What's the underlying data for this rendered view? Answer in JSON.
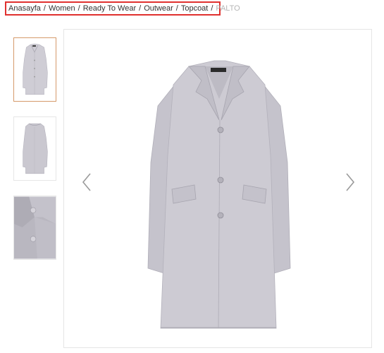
{
  "breadcrumb": {
    "items": [
      "Anasayfa",
      "Women",
      "Ready To Wear",
      "Outwear",
      "Topcoat"
    ],
    "current": "PALTO",
    "separator": "/"
  },
  "gallery": {
    "thumbnails": [
      "coat-front",
      "coat-back",
      "coat-detail"
    ],
    "active_index": 0,
    "main_image": "grey-boucle-coat",
    "prev_icon": "chevron-left-icon",
    "next_icon": "chevron-right-icon"
  },
  "colors": {
    "highlight_border": "#e0312f",
    "active_thumb_border": "#d59a6a",
    "coat": "#c9c7cf",
    "breadcrumb_current": "#b5b5b5"
  }
}
